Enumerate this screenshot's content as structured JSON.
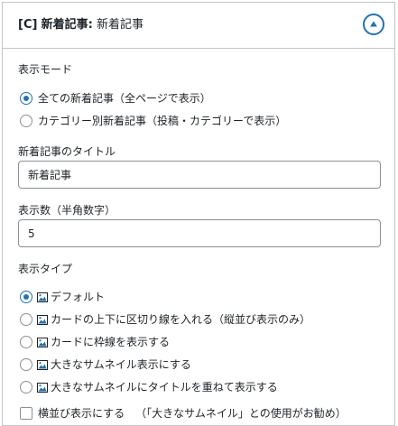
{
  "header": {
    "prefix": "[C]",
    "widget_name": "新着記事",
    "colon": ":",
    "instance_title": "新着記事"
  },
  "display_mode": {
    "label": "表示モード",
    "options": [
      {
        "label": "全ての新着記事（全ページで表示）",
        "checked": true
      },
      {
        "label": "カテゴリー別新着記事（投稿・カテゴリーで表示）",
        "checked": false
      }
    ]
  },
  "title_field": {
    "label": "新着記事のタイトル",
    "value": "新着記事"
  },
  "count_field": {
    "label": "表示数（半角数字）",
    "value": "5"
  },
  "display_type": {
    "label": "表示タイプ",
    "options": [
      {
        "label": "デフォルト",
        "checked": true,
        "icon": "image-icon"
      },
      {
        "label": "カードの上下に区切り線を入れる（縦並び表示のみ）",
        "checked": false,
        "icon": "image-icon"
      },
      {
        "label": "カードに枠線を表示する",
        "checked": false,
        "icon": "image-icon"
      },
      {
        "label": "大きなサムネイル表示にする",
        "checked": false,
        "icon": "image-icon"
      },
      {
        "label": "大きなサムネイルにタイトルを重ねて表示する",
        "checked": false,
        "icon": "image-icon"
      }
    ]
  },
  "horizontal": {
    "label": "横並び表示にする",
    "note": "（「大きなサムネイル」との使用がお勧め）",
    "checked": false
  },
  "colors": {
    "accent": "#2271b1",
    "border": "#c3c4c7",
    "text": "#1d2327"
  }
}
